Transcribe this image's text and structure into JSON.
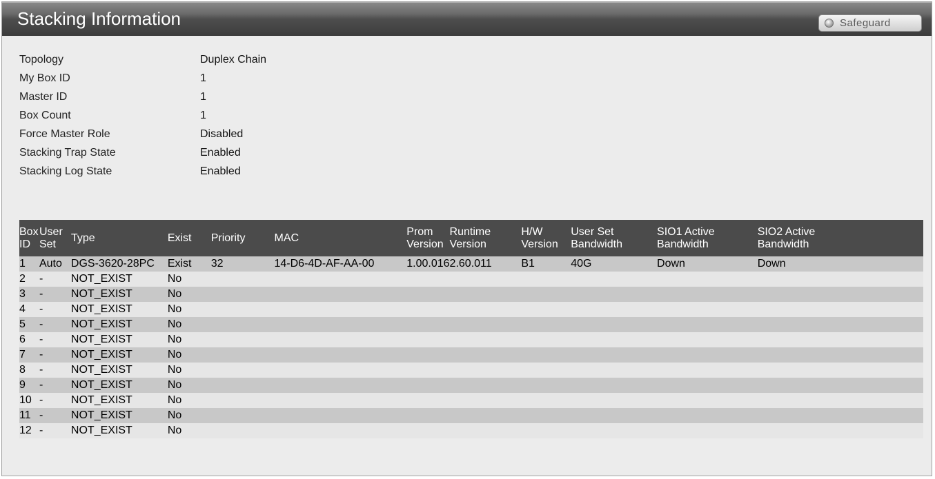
{
  "window": {
    "title": "Stacking Information",
    "safeguard_label": "Safeguard"
  },
  "info": [
    {
      "label": "Topology",
      "value": "Duplex Chain"
    },
    {
      "label": "My Box ID",
      "value": "1"
    },
    {
      "label": "Master ID",
      "value": "1"
    },
    {
      "label": "Box Count",
      "value": "1"
    },
    {
      "label": "Force Master Role",
      "value": "Disabled"
    },
    {
      "label": "Stacking Trap State",
      "value": "Enabled"
    },
    {
      "label": "Stacking Log State",
      "value": "Enabled"
    }
  ],
  "table": {
    "headers": [
      [
        "Box",
        "ID"
      ],
      [
        "User",
        "Set"
      ],
      [
        "Type"
      ],
      [
        "Exist"
      ],
      [
        "Priority"
      ],
      [
        "MAC"
      ],
      [
        "Prom",
        "Version"
      ],
      [
        "Runtime",
        "Version"
      ],
      [
        "H/W",
        "Version"
      ],
      [
        "User Set",
        "Bandwidth"
      ],
      [
        "SIO1 Active",
        "Bandwidth"
      ],
      [
        "SIO2 Active",
        "Bandwidth"
      ]
    ],
    "rows": [
      [
        "1",
        "Auto",
        "DGS-3620-28PC",
        "Exist",
        "32",
        "14-D6-4D-AF-AA-00",
        "1.00.016",
        "2.60.011",
        "B1",
        "40G",
        "Down",
        "Down"
      ],
      [
        "2",
        "-",
        "NOT_EXIST",
        "No",
        "",
        "",
        "",
        "",
        "",
        "",
        "",
        ""
      ],
      [
        "3",
        "-",
        "NOT_EXIST",
        "No",
        "",
        "",
        "",
        "",
        "",
        "",
        "",
        ""
      ],
      [
        "4",
        "-",
        "NOT_EXIST",
        "No",
        "",
        "",
        "",
        "",
        "",
        "",
        "",
        ""
      ],
      [
        "5",
        "-",
        "NOT_EXIST",
        "No",
        "",
        "",
        "",
        "",
        "",
        "",
        "",
        ""
      ],
      [
        "6",
        "-",
        "NOT_EXIST",
        "No",
        "",
        "",
        "",
        "",
        "",
        "",
        "",
        ""
      ],
      [
        "7",
        "-",
        "NOT_EXIST",
        "No",
        "",
        "",
        "",
        "",
        "",
        "",
        "",
        ""
      ],
      [
        "8",
        "-",
        "NOT_EXIST",
        "No",
        "",
        "",
        "",
        "",
        "",
        "",
        "",
        ""
      ],
      [
        "9",
        "-",
        "NOT_EXIST",
        "No",
        "",
        "",
        "",
        "",
        "",
        "",
        "",
        ""
      ],
      [
        "10",
        "-",
        "NOT_EXIST",
        "No",
        "",
        "",
        "",
        "",
        "",
        "",
        "",
        ""
      ],
      [
        "11",
        "-",
        "NOT_EXIST",
        "No",
        "",
        "",
        "",
        "",
        "",
        "",
        "",
        ""
      ],
      [
        "12",
        "-",
        "NOT_EXIST",
        "No",
        "",
        "",
        "",
        "",
        "",
        "",
        "",
        ""
      ]
    ]
  }
}
